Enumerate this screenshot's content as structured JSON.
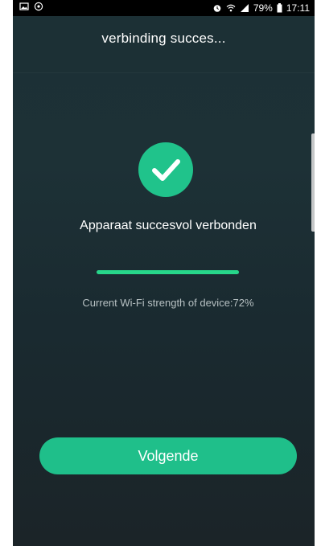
{
  "status_bar": {
    "battery_percent": "79%",
    "time": "17:11",
    "left_icons": [
      "image-icon",
      "whatsapp-icon"
    ],
    "right_icons": [
      "alarm-icon",
      "wifi-icon",
      "signal-icon",
      "battery-icon"
    ]
  },
  "header": {
    "title": "verbinding succes..."
  },
  "main": {
    "success_icon": "check-icon",
    "success_message": "Apparaat succesvol verbonden",
    "progress": 1.0,
    "wifi_strength_text": "Current Wi-Fi strength of device:72%"
  },
  "actions": {
    "next_label": "Volgende"
  },
  "colors": {
    "accent_green": "#20c38b",
    "background": "#1c3036",
    "status_bar": "#000000"
  }
}
